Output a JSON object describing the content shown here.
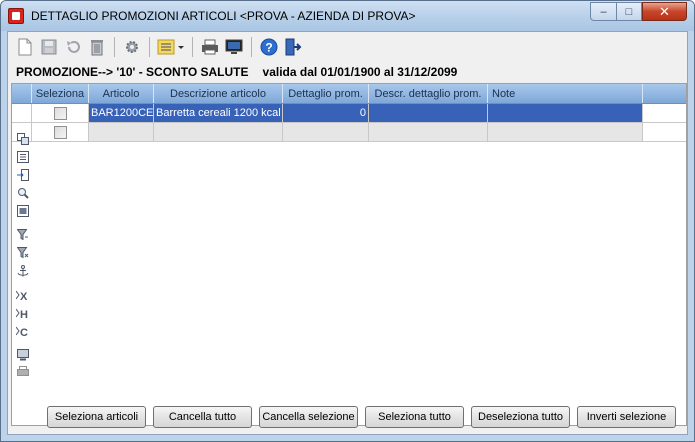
{
  "window": {
    "title": "DETTAGLIO PROMOZIONI ARTICOLI <PROVA - AZIENDA DI PROVA>",
    "controls": {
      "minimize": "–",
      "maximize": "□",
      "close": "✕"
    }
  },
  "toolbar": {
    "buttons": [
      {
        "icon": "new-document-icon"
      },
      {
        "icon": "save-icon"
      },
      {
        "icon": "undo-icon"
      },
      {
        "icon": "delete-icon"
      },
      {
        "icon": "settings-gear-icon"
      },
      {
        "icon": "list-view-dropdown-icon"
      },
      {
        "icon": "print-icon"
      },
      {
        "icon": "preview-monitor-icon"
      },
      {
        "icon": "help-icon"
      },
      {
        "icon": "exit-door-icon"
      }
    ]
  },
  "promo": {
    "label": "PROMOZIONE--> '10' - SCONTO SALUTE",
    "validity": "valida dal 01/01/1900 al 31/12/2099"
  },
  "grid": {
    "columns": [
      "Seleziona",
      "Articolo",
      "Descrizione articolo",
      "Dettaglio prom.",
      "Descr. dettaglio prom.",
      "Note"
    ],
    "rows": [
      {
        "articolo": "BAR1200CE",
        "descrizione": "Barretta cereali 1200 kcal",
        "dettaglio": "0",
        "descr_dettaglio": "",
        "note": ""
      },
      {
        "articolo": "",
        "descrizione": "",
        "dettaglio": "",
        "descr_dettaglio": "",
        "note": ""
      }
    ]
  },
  "side_tools": [
    "copy-rows-icon",
    "list-icon",
    "import-icon",
    "zoom-icon",
    "grid-view-icon",
    "filter-icon",
    "filter-clear-icon",
    "anchor-icon",
    "export-excel-icon",
    "export-html-icon",
    "export-csv-icon",
    "monitor-icon",
    "print-small-icon"
  ],
  "bottom_buttons": {
    "seleziona_articoli": "Seleziona articoli",
    "cancella_tutto": "Cancella tutto",
    "cancella_selezione": "Cancella selezione",
    "seleziona_tutto": "Seleziona tutto",
    "deseleziona_tutto": "Deseleziona tutto",
    "inverti_selezione": "Inverti selezione"
  }
}
